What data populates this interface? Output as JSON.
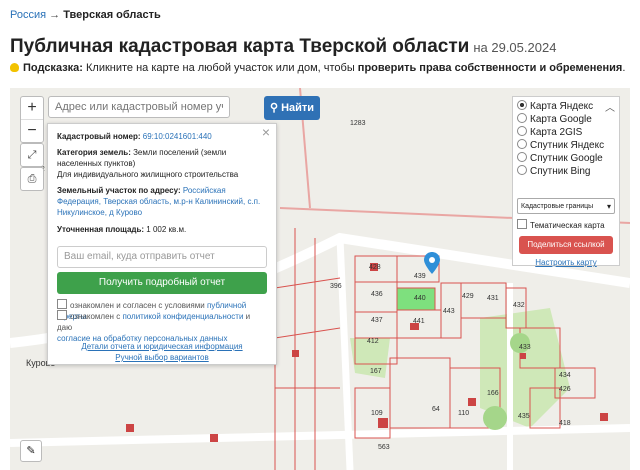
{
  "breadcrumb": {
    "home": "Россия",
    "sep": "→",
    "current": "Тверская область"
  },
  "title": "Публичная кадастровая карта Тверской области",
  "date": "на 29.05.2024",
  "hint": {
    "label": "Подсказка:",
    "text": "Кликните на карте на любой участок или дом, чтобы",
    "bold": "проверить права собственности и обременения",
    "end": "."
  },
  "map": {
    "search_placeholder": "Адрес или кадастровый номер участка",
    "find_label": "Найти",
    "zoom_in": "+",
    "zoom_out": "−",
    "parcel_labels": [
      "1283",
      "428",
      "439",
      "436",
      "440",
      "429",
      "431",
      "432",
      "437",
      "441",
      "443",
      "412",
      "433",
      "434",
      "426",
      "167",
      "166",
      "109",
      "64",
      "110",
      "435",
      "418",
      "563",
      "396",
      "42",
      "Курово"
    ]
  },
  "popup": {
    "cad_label": "Кадастровый номер:",
    "cad_value": "69:10:0241601:440",
    "cat_label": "Категория земель:",
    "cat_value": "Земли поселений (земли населенных пунктов)",
    "use_value": "Для индивидуального жилищного строительства",
    "addr_label": "Земельный участок по адресу:",
    "addr_value": "Российская Федерация, Тверская область, м.р-н Калининский, с.п. Никулинское, д Курово",
    "area_label": "Уточненная площадь:",
    "area_value": "1 002 кв.м.",
    "email_placeholder": "Ваш email, куда отправить отчет",
    "get_report": "Получить подробный отчет",
    "agree1_a": "ознакомлен и согласен с условиями",
    "agree1_b": "публичной оферты",
    "agree2_a": "ознакомлен с",
    "agree2_b": "политикой конфиденциальности",
    "agree2_c": "и даю",
    "agree2_d": "согласие на обработку персональных данных",
    "link1": "Детали отчета и юридическая информация",
    "link2": "Ручной выбор вариантов"
  },
  "layers": {
    "options": [
      "Карта Яндекс",
      "Карта Google",
      "Карта 2GIS",
      "Спутник Яндекс",
      "Спутник Google",
      "Спутник Bing"
    ],
    "selected": 0,
    "borders": "Кадастровые границы",
    "thematic": "Тематическая карта",
    "share": "Поделиться ссылкой",
    "setup": "Настроить карту"
  },
  "colors": {
    "accent": "#2f71b5",
    "green": "#3ea14b",
    "red": "#d9534f",
    "parcel_border": "#d9534f"
  }
}
